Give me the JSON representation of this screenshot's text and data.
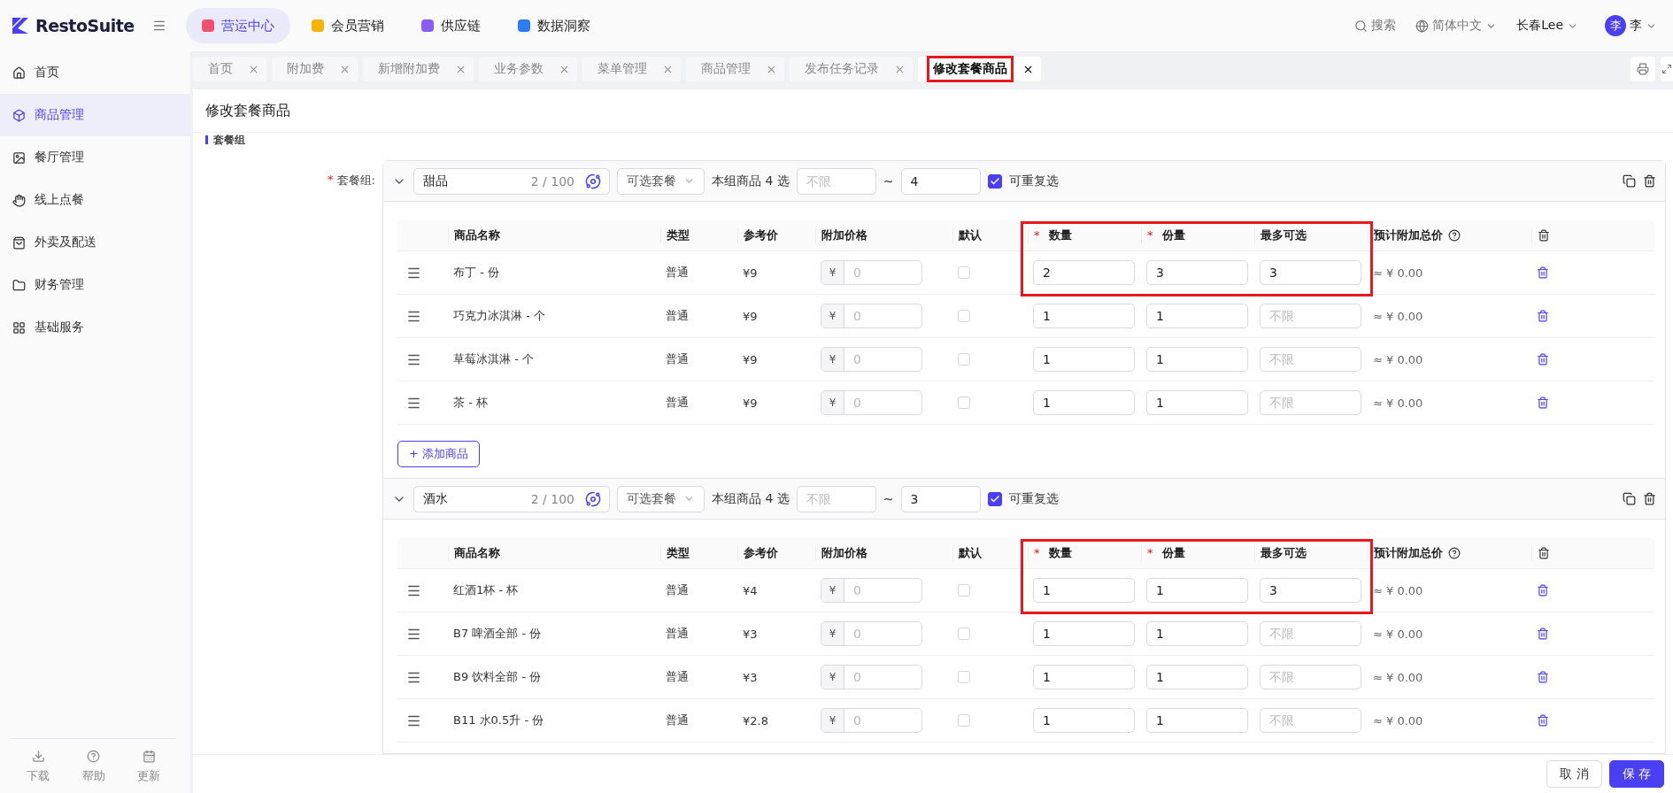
{
  "brand": {
    "name": "RestoSuite"
  },
  "top_nav": [
    {
      "label": "营运中心",
      "selected": true,
      "color": "#f0506e"
    },
    {
      "label": "会员营销",
      "selected": false,
      "color": "#f5b400"
    },
    {
      "label": "供应链",
      "selected": false,
      "color": "#8a5cf6"
    },
    {
      "label": "数据洞察",
      "selected": false,
      "color": "#2b7cf6"
    }
  ],
  "header_right": {
    "search": "搜索",
    "language": "简体中文",
    "store": "长春Lee",
    "avatar": "李",
    "user": "李"
  },
  "sidebar": {
    "items": [
      {
        "label": "首页",
        "selected": false
      },
      {
        "label": "商品管理",
        "selected": true
      },
      {
        "label": "餐厅管理",
        "selected": false
      },
      {
        "label": "线上点餐",
        "selected": false
      },
      {
        "label": "外卖及配送",
        "selected": false
      },
      {
        "label": "财务管理",
        "selected": false
      },
      {
        "label": "基础服务",
        "selected": false
      }
    ],
    "footer": [
      {
        "label": "下载"
      },
      {
        "label": "帮助"
      },
      {
        "label": "更新"
      }
    ]
  },
  "tabs": [
    {
      "label": "首页",
      "selected": false,
      "annotated": false
    },
    {
      "label": "附加费",
      "selected": false,
      "annotated": false
    },
    {
      "label": "新增附加费",
      "selected": false,
      "annotated": false
    },
    {
      "label": "业务参数",
      "selected": false,
      "annotated": false
    },
    {
      "label": "菜单管理",
      "selected": false,
      "annotated": false
    },
    {
      "label": "商品管理",
      "selected": false,
      "annotated": false
    },
    {
      "label": "发布任务记录",
      "selected": false,
      "annotated": false
    },
    {
      "label": "修改套餐商品",
      "selected": true,
      "annotated": true
    }
  ],
  "page_title": "修改套餐商品",
  "section_title": "套餐组",
  "form_label": {
    "mark": "*",
    "text": "套餐组:"
  },
  "groups": [
    {
      "expanded": true,
      "name": "甜品",
      "counter": "2 / 100",
      "mode": "可选套餐",
      "choose_label": "本组商品 4 选",
      "min_placeholder": "不限",
      "tilde": "~",
      "max": "4",
      "repeat": {
        "label": "可重复选",
        "checked": true
      },
      "annotated": true,
      "add_button": "+ 添加商品",
      "columns": [
        {
          "label": "商品名称",
          "help": false
        },
        {
          "label": "类型",
          "help": false
        },
        {
          "label": "参考价",
          "help": false
        },
        {
          "label": "附加价格",
          "help": false
        },
        {
          "label": "默认",
          "help": false
        },
        {
          "mark": "*",
          "label": "数量",
          "help": false
        },
        {
          "mark": "*",
          "label": "份量",
          "help": false
        },
        {
          "label": "最多可选",
          "help": false
        },
        {
          "label": "预计附加总价",
          "help": true
        }
      ],
      "rows": [
        {
          "name": "布丁 - 份",
          "type": "普通",
          "price": "¥9",
          "currency": "¥",
          "addon_placeholder": "0",
          "default": false,
          "qty": "2",
          "portion": "3",
          "max": "3",
          "max_placeholder": "",
          "estimate": "≈ ¥ 0.00"
        },
        {
          "name": "巧克力冰淇淋 - 个",
          "type": "普通",
          "price": "¥9",
          "currency": "¥",
          "addon_placeholder": "0",
          "default": false,
          "qty": "1",
          "portion": "1",
          "max": "",
          "max_placeholder": "不限",
          "estimate": "≈ ¥ 0.00"
        },
        {
          "name": "草莓冰淇淋 - 个",
          "type": "普通",
          "price": "¥9",
          "currency": "¥",
          "addon_placeholder": "0",
          "default": false,
          "qty": "1",
          "portion": "1",
          "max": "",
          "max_placeholder": "不限",
          "estimate": "≈ ¥ 0.00"
        },
        {
          "name": "茶 - 杯",
          "type": "普通",
          "price": "¥9",
          "currency": "¥",
          "addon_placeholder": "0",
          "default": false,
          "qty": "1",
          "portion": "1",
          "max": "",
          "max_placeholder": "不限",
          "estimate": "≈ ¥ 0.00"
        }
      ]
    },
    {
      "expanded": true,
      "name": "酒水",
      "counter": "2 / 100",
      "mode": "可选套餐",
      "choose_label": "本组商品 4 选",
      "min_placeholder": "不限",
      "tilde": "~",
      "max": "3",
      "repeat": {
        "label": "可重复选",
        "checked": true
      },
      "annotated": true,
      "columns": [
        {
          "label": "商品名称",
          "help": false
        },
        {
          "label": "类型",
          "help": false
        },
        {
          "label": "参考价",
          "help": false
        },
        {
          "label": "附加价格",
          "help": false
        },
        {
          "label": "默认",
          "help": false
        },
        {
          "mark": "*",
          "label": "数量",
          "help": false
        },
        {
          "mark": "*",
          "label": "份量",
          "help": false
        },
        {
          "label": "最多可选",
          "help": false
        },
        {
          "label": "预计附加总价",
          "help": true
        }
      ],
      "rows": [
        {
          "name": "红酒1杯 - 杯",
          "type": "普通",
          "price": "¥4",
          "currency": "¥",
          "addon_placeholder": "0",
          "default": false,
          "qty": "1",
          "portion": "1",
          "max": "3",
          "max_placeholder": "",
          "estimate": "≈ ¥ 0.00"
        },
        {
          "name": "B7 啤酒全部 - 份",
          "type": "普通",
          "price": "¥3",
          "currency": "¥",
          "addon_placeholder": "0",
          "default": false,
          "qty": "1",
          "portion": "1",
          "max": "",
          "max_placeholder": "不限",
          "estimate": "≈ ¥ 0.00"
        },
        {
          "name": "B9 饮料全部 - 份",
          "type": "普通",
          "price": "¥3",
          "currency": "¥",
          "addon_placeholder": "0",
          "default": false,
          "qty": "1",
          "portion": "1",
          "max": "",
          "max_placeholder": "不限",
          "estimate": "≈ ¥ 0.00"
        },
        {
          "name": "B11 水0.5升 - 份",
          "type": "普通",
          "price": "¥2.8",
          "currency": "¥",
          "addon_placeholder": "0",
          "default": false,
          "qty": "1",
          "portion": "1",
          "max": "",
          "max_placeholder": "不限",
          "estimate": "≈ ¥ 0.00"
        }
      ]
    }
  ],
  "footer_buttons": [
    {
      "label": "取 消",
      "kind": "default"
    },
    {
      "label": "保 存",
      "kind": "primary"
    }
  ]
}
